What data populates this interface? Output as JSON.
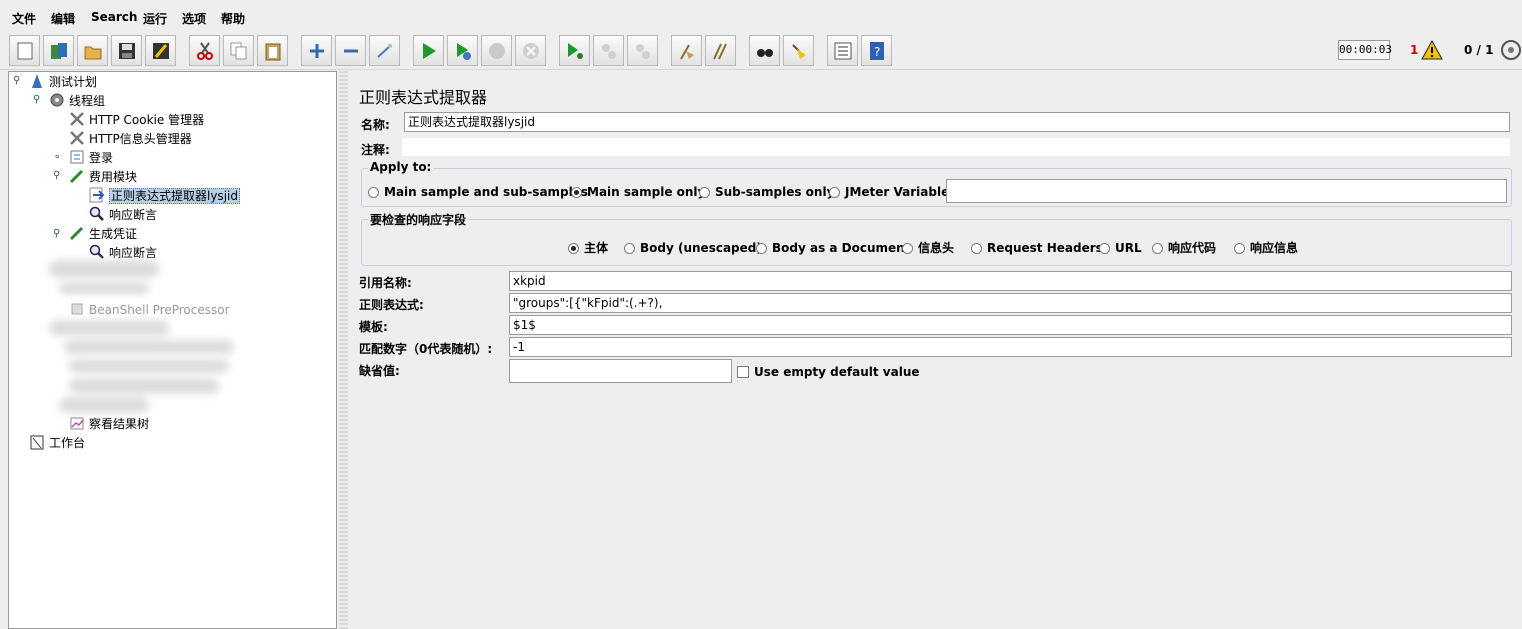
{
  "menu": [
    "文件",
    "编辑",
    "Search",
    "运行",
    "选项",
    "帮助"
  ],
  "status": {
    "elapsed": "00:00:03",
    "error_count": "1",
    "threads": "0 / 1"
  },
  "tree": [
    {
      "label": "测试计划",
      "icon": "test-plan-icon"
    },
    {
      "label": "线程组",
      "icon": "thread-group-icon"
    },
    {
      "label": "HTTP Cookie 管理器",
      "icon": "config-tools-icon"
    },
    {
      "label": "HTTP信息头管理器",
      "icon": "config-tools-icon"
    },
    {
      "label": "登录",
      "icon": "transaction-icon"
    },
    {
      "label": "费用模块",
      "icon": "sampler-pen-icon"
    },
    {
      "label": "正则表达式提取器lysjid",
      "icon": "extractor-arrow-icon"
    },
    {
      "label": "响应断言",
      "icon": "assertion-magnifier-icon"
    },
    {
      "label": "生成凭证",
      "icon": "sampler-pen-icon"
    },
    {
      "label": "响应断言",
      "icon": "assertion-magnifier-icon"
    },
    {
      "label": "BeanShell PreProcessor",
      "icon": "preprocessor-icon"
    },
    {
      "label": "察看结果树",
      "icon": "listener-chart-icon"
    },
    {
      "label": "工作台",
      "icon": "workbench-icon"
    }
  ],
  "panel": {
    "title": "正则表达式提取器",
    "name_label": "名称:",
    "name_value": "正则表达式提取器lysjid",
    "comment_label": "注释:",
    "comment_value": "",
    "apply_to": {
      "title": "Apply to:",
      "options": [
        "Main sample and sub-samples",
        "Main sample only",
        "Sub-samples only",
        "JMeter Variable"
      ],
      "selected": "Main sample only",
      "variable_value": ""
    },
    "field_check": {
      "title": "要检查的响应字段",
      "options": [
        "主体",
        "Body (unescaped)",
        "Body as a Document",
        "信息头",
        "Request Headers",
        "URL",
        "响应代码",
        "响应信息"
      ],
      "selected": "主体"
    },
    "ref_name_label": "引用名称:",
    "ref_name_value": "xkpid",
    "regex_label": "正则表达式:",
    "regex_value": "\"groups\":[{\"kFpid\":(.+?),",
    "template_label": "模板:",
    "template_value": "$1$",
    "match_no_label": "匹配数字（0代表随机）:",
    "match_no_value": "-1",
    "default_label": "缺省值:",
    "default_value": "",
    "use_empty_label": "Use empty default value",
    "use_empty_checked": false
  }
}
